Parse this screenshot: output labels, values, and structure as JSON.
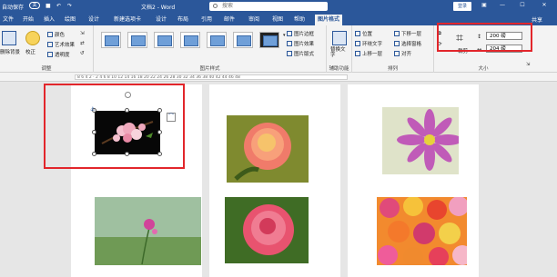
{
  "titlebar": {
    "autosave": "自动保存",
    "autosave_state": "关",
    "doc_title": "文档2 - Word",
    "search_placeholder": "搜索",
    "login": "登录"
  },
  "tabs": [
    "文件",
    "开始",
    "插入",
    "绘图",
    "设计",
    "新建选项卡",
    "设计",
    "布局",
    "引用",
    "邮件",
    "审阅",
    "视图",
    "帮助",
    "图片格式"
  ],
  "active_tab": "图片格式",
  "share": "共享",
  "ribbon": {
    "adjust": {
      "remove_bg": "删除背景",
      "corrections": "校正",
      "color": "颜色",
      "artistic": "艺术效果",
      "transparency": "透明度",
      "label": "调整"
    },
    "styles": {
      "label": "图片样式",
      "border": "图片边框",
      "effects": "图片效果",
      "layout": "图片版式"
    },
    "accessibility": {
      "alt_text": "替换文字",
      "label": "辅助功能"
    },
    "arrange": {
      "position": "位置",
      "wrap": "环绕文字",
      "forward": "上移一层",
      "backward": "下移一层",
      "selection": "选择窗格",
      "align": "对齐",
      "label": "排列"
    },
    "size": {
      "crop": "裁剪",
      "height": "200 磅",
      "width": "204 磅",
      "label": "大小"
    }
  },
  "ruler_text": "8 6 4 2 · 2 4 6 8 10 12 14 16 18 20 22 24 26 28 30 32 34 36 38 40 42 44 46 48",
  "colors": {
    "title_blue": "#2b579a",
    "highlight_red": "#e2262b"
  },
  "photos": [
    {
      "name": "cherry-blossom",
      "caption": ""
    },
    {
      "name": "orange-rose",
      "caption": ""
    },
    {
      "name": "pink-gerbera",
      "caption": ""
    },
    {
      "name": "field-flower",
      "caption": ""
    },
    {
      "name": "pink-rose",
      "caption": ""
    },
    {
      "name": "gerbera-bouquet",
      "caption": ""
    }
  ]
}
